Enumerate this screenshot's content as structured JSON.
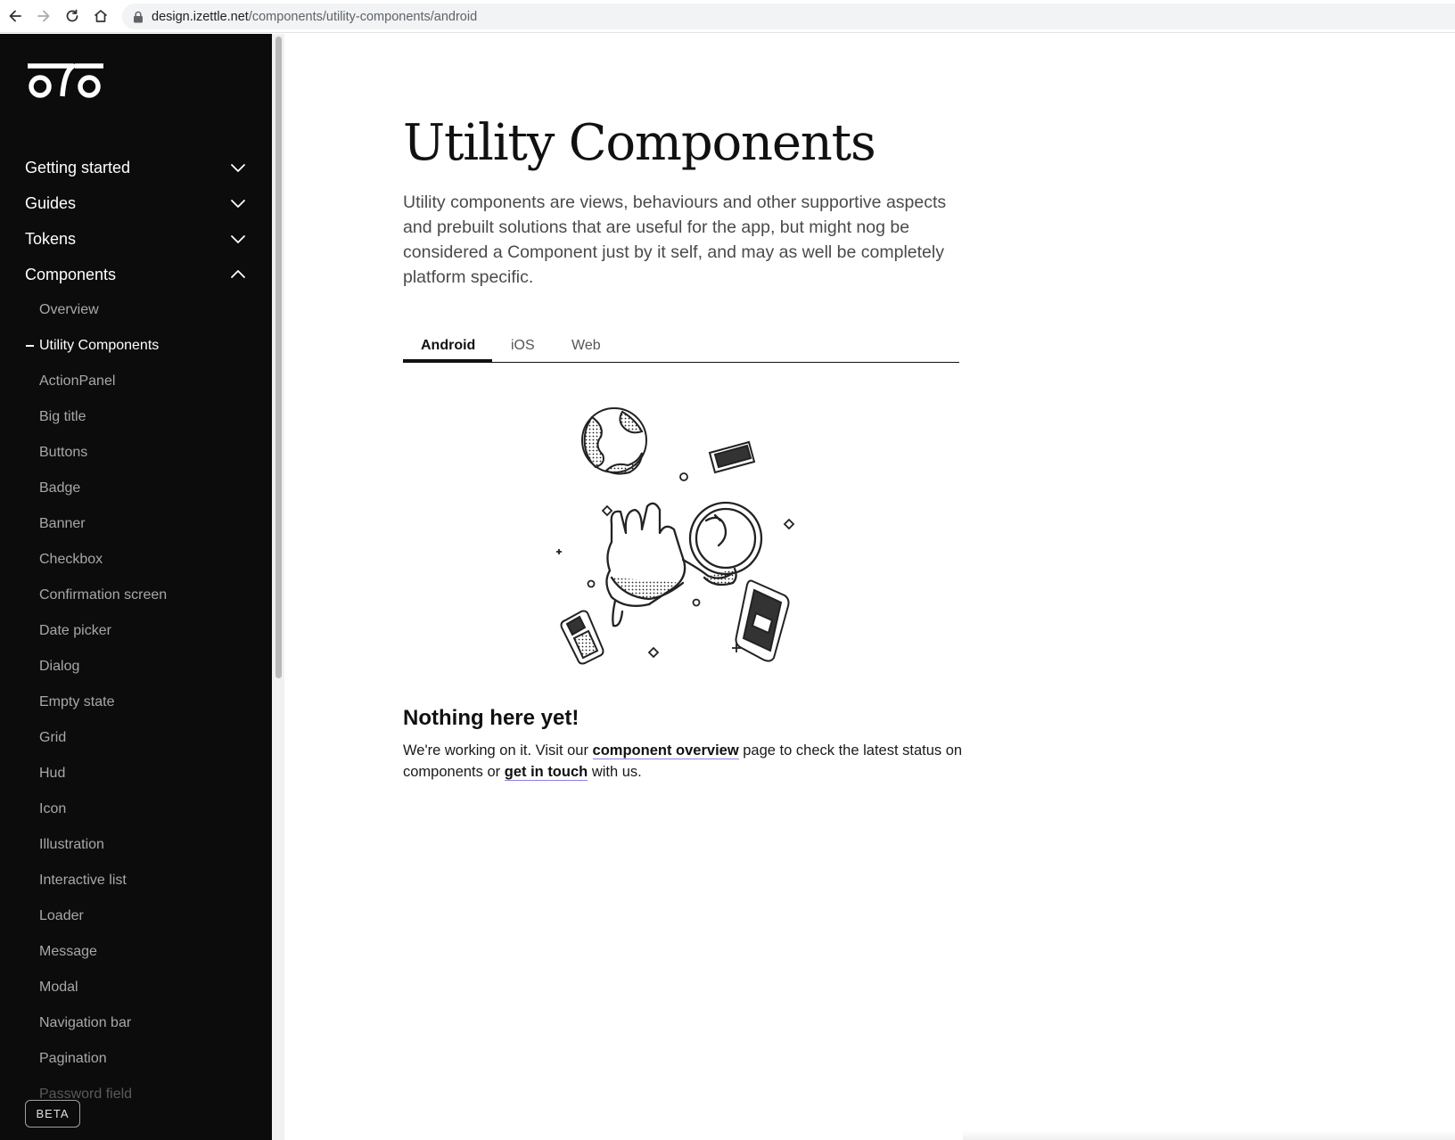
{
  "browser": {
    "url_domain": "design.izettle.net",
    "url_path": "/components/utility-components/android"
  },
  "sidebar": {
    "main_items": [
      {
        "label": "Getting started",
        "expanded": false
      },
      {
        "label": "Guides",
        "expanded": false
      },
      {
        "label": "Tokens",
        "expanded": false
      },
      {
        "label": "Components",
        "expanded": true
      }
    ],
    "sub_items": [
      "Overview",
      "Utility Components",
      "ActionPanel",
      "Big title",
      "Buttons",
      "Badge",
      "Banner",
      "Checkbox",
      "Confirmation screen",
      "Date picker",
      "Dialog",
      "Empty state",
      "Grid",
      "Hud",
      "Icon",
      "Illustration",
      "Interactive list",
      "Loader",
      "Message",
      "Modal",
      "Navigation bar",
      "Pagination",
      "Password field"
    ],
    "active_item": "Utility Components",
    "beta_label": "BETA"
  },
  "main": {
    "title": "Utility Components",
    "intro": "Utility components are views, behaviours and other supportive aspects and prebuilt solutions that are useful for the app, but might nog be considered a Component just by it self, and may as well be completely platform specific.",
    "tabs": [
      "Android",
      "iOS",
      "Web"
    ],
    "active_tab": "Android",
    "empty_state": {
      "title": "Nothing here yet!",
      "text_before": "We're working on it. Visit our ",
      "link_overview": "component overview",
      "text_middle": " page to check the latest status on components or ",
      "link_contact": "get in touch",
      "text_after": " with us."
    }
  }
}
